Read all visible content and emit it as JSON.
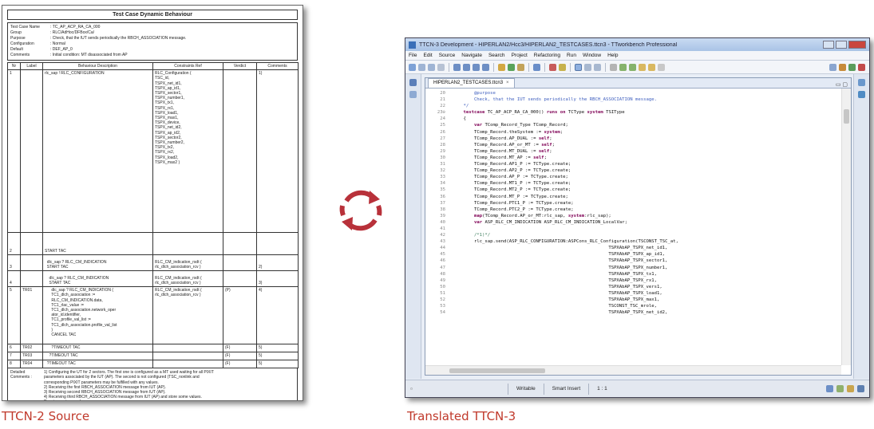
{
  "captions": {
    "left": "TTCN-2 Source",
    "right": "Translated TTCN-3"
  },
  "doc": {
    "title": "Test Case Dynamic Behaviour",
    "header": [
      {
        "key": "Test Case Name",
        "value": ": TC_AP_ACP_RA_CA_000"
      },
      {
        "key": "Group",
        "value": ": RLC/AdHoc/DFBox/Ca/"
      },
      {
        "key": "Purpose",
        "value": ": Check, that the IUT sends periodically the RBCH_ASSOCIATION message."
      },
      {
        "key": "Configuration",
        "value": ": Normal"
      },
      {
        "key": "Default",
        "value": ": DEF_AP_0"
      },
      {
        "key": "Comments",
        "value": ": Initial condition: MT disassociated from AP"
      }
    ],
    "columns": [
      "Nr",
      "Label",
      "Behaviour Description",
      "Constraints Ref",
      "Verdict",
      "Comments"
    ],
    "rows": [
      {
        "nr": "1",
        "label": "",
        "desc": "rlc_sap ! RLC_CONFIGURATION",
        "cref": "RLC_Configuration (\nTSC_id,\nTSPX_net_id1,\nTSPX_ap_id1,\nTSPX_sector1,\nTSPX_number1,\nTSPX_tx1,\nTSPX_rx1,\nTSPX_load1,\nTSPX_max1,\nTSPX_device,\nTSPX_net_id2,\nTSPX_ap_id2,\nTSPX_sector2,\nTSPX_number2,\nTSPX_tx2,\nTSPX_rx2,\nTSPX_load2,\nTSPX_max2 )",
        "verdict": "",
        "comment": "1)"
      },
      {
        "nr": "2",
        "label": "",
        "desc": "START TAC",
        "cref": "",
        "verdict": "",
        "comment": ""
      },
      {
        "nr": "3",
        "label": "",
        "desc": "  dlc_sap ? RLC_CM_INDICATION\n  START TAC",
        "cref": "RLC_CM_indication_rsdt (\nrlc_dlch_association_rcv )",
        "verdict": "",
        "comment": "2)"
      },
      {
        "nr": "4",
        "label": "",
        "desc": "    dlc_sap ? RLC_CM_INDICATION\n    START TAC",
        "cref": "RLC_CM_indication_rsdt (\nrlc_dlch_association_rcv )",
        "verdict": "",
        "comment": "3)"
      },
      {
        "nr": "5",
        "label": "TR01",
        "desc": "      dlc_sap ? RLC_CM_INDICATION (\n      TC1_dlch_association :=\n      RLC_CM_INDICATION.data,\n      TC1_rlac_value :=\n      TC1_dlch_association.network_oper\n      ator_id.identifier,\n      TC1_profile_val_list :=\n      TC1_dlch_association.profile_val_list\n      )\n      CANCEL TAC",
        "cref": "RLC_CM_indication_rsdt (\nrlc_dlch_association_rcv )",
        "verdict": "(P)",
        "comment": "4)"
      },
      {
        "nr": "6",
        "label": "TR02",
        "desc": "      ?TIMEOUT TAC",
        "cref": "",
        "verdict": "(F)",
        "comment": "5)"
      },
      {
        "nr": "7",
        "label": "TR03",
        "desc": "    ?TIMEOUT TAC",
        "cref": "",
        "verdict": "(F)",
        "comment": "5)"
      },
      {
        "nr": "8",
        "label": "TR04",
        "desc": "  ?TIMEOUT TAC",
        "cref": "",
        "verdict": "(F)",
        "comment": "5)"
      }
    ],
    "detailed_key": "Detailed Comments :",
    "detailed": "1) Configuring the UT for 2 sectors. The first one is configured as a MT used waiting for all PIXIT\nparameters associated by the IUT (AP). The second is not configured (TSC_nonlink and\ncorresponding PIXIT parameters may be fulfilled with any values.\n2) Receiving the first RBCH_ASSOCIATION message from IUT (AP).\n3) Receiving second RBCH_ASSOCIATION message from IUT (AP).\n4) Receiving third RBCH_ASSOCIATION message from IUT (AP) and store some values.\nRequirement passed.\n5) Timeout TAC is also matched in the default tree. Nevertheless, for readability reason, the verdict\nis assigned in the test case because the expected behaviour is not reached.\nNo RBCH_ASSOCIATION message not received from IUT (AP). Incomplete verdict"
  },
  "ide": {
    "title": "TTCN-3 Development - HIPERLAN2/Hcc3/HIPERLAN2_TESTCASES.ttcn3 - TTworkbench Professional",
    "menu": [
      "File",
      "Edit",
      "Source",
      "Navigate",
      "Search",
      "Project",
      "Refactoring",
      "Run",
      "Window",
      "Help"
    ],
    "tab": "HIPERLAN2_TESTCASES.ttcn3",
    "code": [
      {
        "n": "20",
        "c": "        @purpose",
        "t": "cd"
      },
      {
        "n": "21",
        "c": "        Check, that the IUT sends periodically the RBCH_ASSOCIATION message.",
        "t": "cd"
      },
      {
        "n": "22",
        "c": "    */",
        "t": "cd"
      },
      {
        "n": "23⊖",
        "c": "    testcase TC_AP_ACP_RA_CA_000() runs on TCType system TSIType",
        "t": "kwline"
      },
      {
        "n": "24",
        "c": "    {",
        "t": "tx"
      },
      {
        "n": "25",
        "c": "        var TComp_Record_Type TComp_Record;",
        "t": "tx"
      },
      {
        "n": "26",
        "c": "        TComp_Record.theSystem := system;",
        "t": "tx"
      },
      {
        "n": "27",
        "c": "        TComp_Record.AP_DUAL := self;",
        "t": "tx"
      },
      {
        "n": "28",
        "c": "        TComp_Record.AP_or_MT := self;",
        "t": "tx"
      },
      {
        "n": "29",
        "c": "        TComp_Record.MT_DUAL := self;",
        "t": "tx"
      },
      {
        "n": "30",
        "c": "        TComp_Record.MT_AP := self;",
        "t": "tx"
      },
      {
        "n": "31",
        "c": "        TComp_Record.AP1_P := TCType.create;",
        "t": "tx"
      },
      {
        "n": "32",
        "c": "        TComp_Record.AP2_P := TCType.create;",
        "t": "tx"
      },
      {
        "n": "33",
        "c": "        TComp_Record.AP_P := TCType.create;",
        "t": "tx"
      },
      {
        "n": "34",
        "c": "        TComp_Record.MT1_P := TCType.create;",
        "t": "tx"
      },
      {
        "n": "35",
        "c": "        TComp_Record.MT2_P := TCType.create;",
        "t": "tx"
      },
      {
        "n": "36",
        "c": "        TComp_Record.MT_P := TCType.create;",
        "t": "tx"
      },
      {
        "n": "37",
        "c": "        TComp_Record.PTC1_P := TCType.create;",
        "t": "tx"
      },
      {
        "n": "38",
        "c": "        TComp_Record.PTC2_P := TCType.create;",
        "t": "tx"
      },
      {
        "n": "39",
        "c": "        map(TComp_Record.AP_or_MT:rlc_sap, system:rlc_sap);",
        "t": "tx"
      },
      {
        "n": "40",
        "c": "        var ASP_RLC_CM_INDICATION ASP_RLC_CM_INDICATION_LocalVar;",
        "t": "tx"
      },
      {
        "n": "41",
        "c": "",
        "t": "tx"
      },
      {
        "n": "42",
        "c": "        /*1)*/",
        "t": "cm"
      },
      {
        "n": "43",
        "c": "        rlc_sap.send(ASP_RLC_CONFIGURATION:ASPCons_RLC_Configuration(TSCONST_TSC_at,",
        "t": "tx"
      },
      {
        "n": "44",
        "c": "                                                          TSPXAbAP_TSPX_net_id1,",
        "t": "tx"
      },
      {
        "n": "45",
        "c": "                                                          TSPXAbAP_TSPX_ap_id1,",
        "t": "tx"
      },
      {
        "n": "46",
        "c": "                                                          TSPXAbAP_TSPX_sector1,",
        "t": "tx"
      },
      {
        "n": "47",
        "c": "                                                          TSPXAbAP_TSPX_number1,",
        "t": "tx"
      },
      {
        "n": "48",
        "c": "                                                          TSPXAbAP_TSPX_tx1,",
        "t": "tx"
      },
      {
        "n": "49",
        "c": "                                                          TSPXAbAP_TSPX_rx1,",
        "t": "tx"
      },
      {
        "n": "50",
        "c": "                                                          TSPXAbAP_TSPX_vers1,",
        "t": "tx"
      },
      {
        "n": "51",
        "c": "                                                          TSPXAbAP_TSPX_load1,",
        "t": "tx"
      },
      {
        "n": "52",
        "c": "                                                          TSPXAbAP_TSPX_max1,",
        "t": "tx"
      },
      {
        "n": "53",
        "c": "                                                          TSCONST_TSC_mrole,",
        "t": "tx"
      },
      {
        "n": "54",
        "c": "                                                          TSPXAbAP_TSPX_net_id2,",
        "t": "tx"
      }
    ],
    "status": [
      "Writable",
      "Smart Insert",
      "1 : 1"
    ]
  }
}
